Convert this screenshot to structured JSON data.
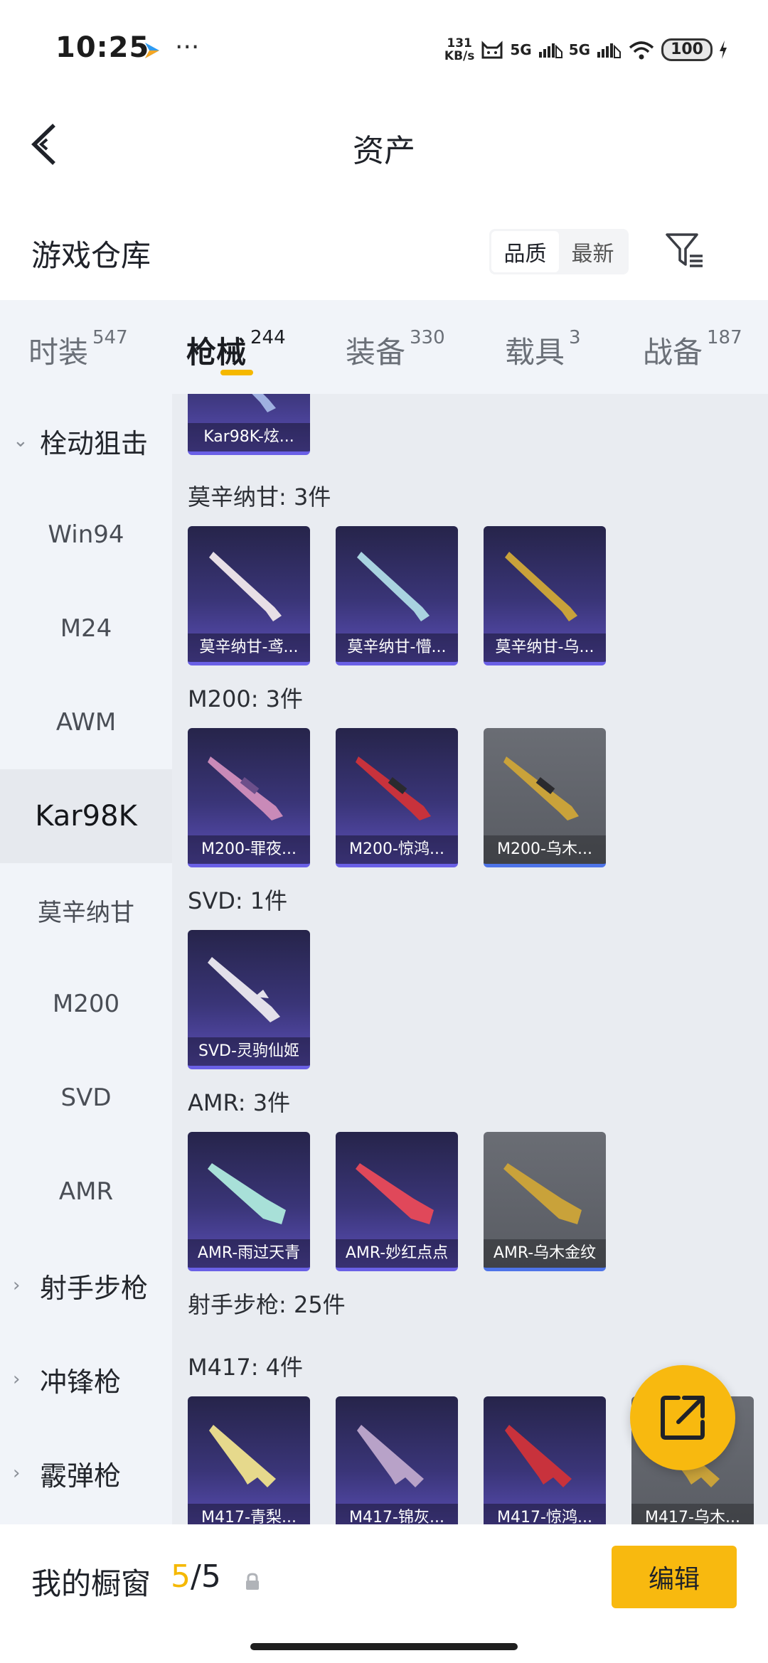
{
  "status_bar": {
    "time": "10:25",
    "speed_value": "131",
    "speed_unit": "KB/s",
    "signal1": "5G",
    "signal2": "5G",
    "battery": "100"
  },
  "header": {
    "title": "资产"
  },
  "warehouse": {
    "title": "游戏仓库",
    "sort_options": [
      "品质",
      "最新"
    ],
    "sort_selected": "品质"
  },
  "tabs": [
    {
      "label": "时装",
      "count": "547"
    },
    {
      "label": "枪械",
      "count": "244"
    },
    {
      "label": "装备",
      "count": "330"
    },
    {
      "label": "载具",
      "count": "3"
    },
    {
      "label": "战备",
      "count": "187"
    }
  ],
  "sidebar": {
    "items": [
      {
        "label": "栓动狙击",
        "group": true,
        "expanded": true
      },
      {
        "label": "Win94"
      },
      {
        "label": "M24"
      },
      {
        "label": "AWM"
      },
      {
        "label": "Kar98K",
        "selected": true
      },
      {
        "label": "莫辛纳甘"
      },
      {
        "label": "M200"
      },
      {
        "label": "SVD"
      },
      {
        "label": "AMR"
      },
      {
        "label": "射手步枪",
        "group": true
      },
      {
        "label": "冲锋枪",
        "group": true
      },
      {
        "label": "霰弹枪",
        "group": true
      }
    ]
  },
  "content": {
    "partial_card": {
      "label": "Kar98K-炫..."
    },
    "sections": [
      {
        "title": "莫辛纳甘: 3件",
        "items": [
          {
            "label": "莫辛纳甘-鸢...",
            "color": "#e8dfe6"
          },
          {
            "label": "莫辛纳甘-懵...",
            "color": "#a9d3e0"
          },
          {
            "label": "莫辛纳甘-乌...",
            "color": "#c9a23a"
          }
        ]
      },
      {
        "title": "M200: 3件",
        "items": [
          {
            "label": "M200-罪夜...",
            "color": "#c98ab8"
          },
          {
            "label": "M200-惊鸿...",
            "color": "#c8323c"
          },
          {
            "label": "M200-乌木...",
            "color": "#c9a23a",
            "gray": true
          }
        ]
      },
      {
        "title": "SVD: 1件",
        "items": [
          {
            "label": "SVD-灵驹仙姬",
            "color": "#e3e0ea"
          }
        ]
      },
      {
        "title": "AMR: 3件",
        "items": [
          {
            "label": "AMR-雨过天青",
            "color": "#a8e0d8"
          },
          {
            "label": "AMR-妙红点点",
            "color": "#e0485a"
          },
          {
            "label": "AMR-乌木金纹",
            "color": "#c9a23a",
            "gray": true
          }
        ]
      }
    ],
    "group_header": "射手步枪: 25件",
    "m417": {
      "title": "M417: 4件",
      "items": [
        {
          "label": "M417-青梨...",
          "color": "#e6d98c"
        },
        {
          "label": "M417-锦灰...",
          "color": "#b8a2c8"
        },
        {
          "label": "M417-惊鸿...",
          "color": "#c8323c"
        },
        {
          "label": "M417-乌木...",
          "color": "#c9a23a",
          "gray": true
        }
      ]
    }
  },
  "bottom_bar": {
    "title": "我的橱窗",
    "count_current": "5",
    "count_total": "/5",
    "edit_label": "编辑"
  }
}
